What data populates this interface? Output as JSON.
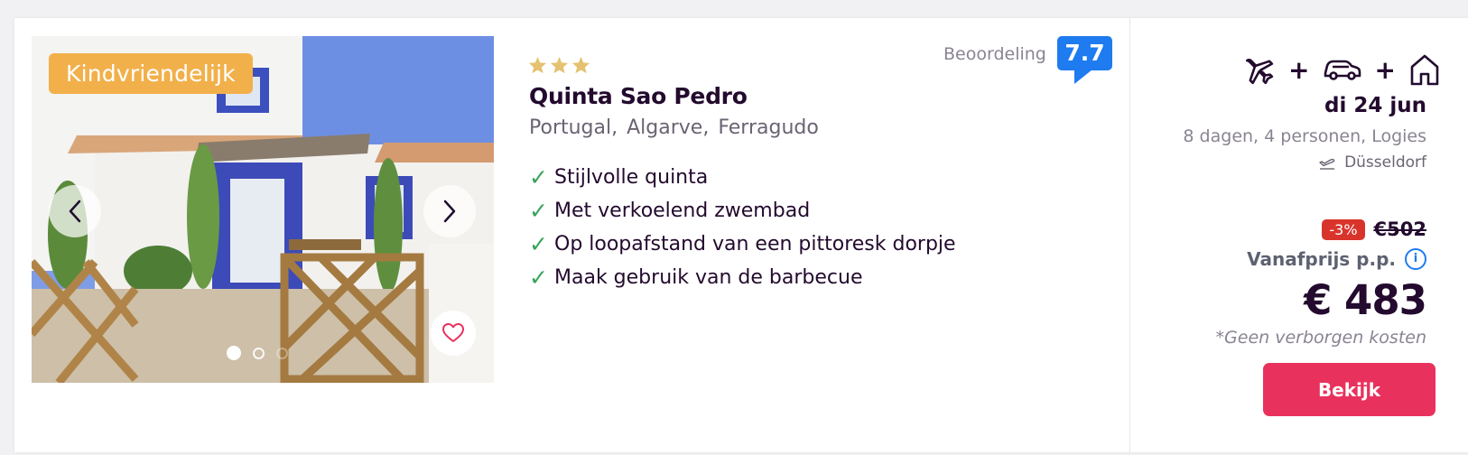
{
  "badge": {
    "label": "Kindvriendelijk"
  },
  "hotel": {
    "stars": 3,
    "name": "Quinta Sao Pedro",
    "location": [
      "Portugal,",
      "Algarve,",
      "Ferragudo"
    ]
  },
  "usps": [
    "Stijlvolle quinta",
    "Met verkoelend zwembad",
    "Op loopafstand van een pittoresk dorpje",
    "Maak gebruik van de barbecue"
  ],
  "rating": {
    "label": "Beoordeling",
    "score": "7.7"
  },
  "trip": {
    "transport_icons": [
      "plane-icon",
      "car-icon",
      "house-icon"
    ],
    "plus": "+",
    "date": "di 24 jun",
    "details": "8 dagen, 4 personen, Logies",
    "departure": "Düsseldorf"
  },
  "pricing": {
    "discount": "-3%",
    "old_price": "€502",
    "from_label": "Vanafprijs p.p.",
    "price": "€ 483",
    "note": "*Geen verborgen kosten",
    "cta": "Bekijk"
  },
  "carousel": {
    "total": 3,
    "active": 1
  },
  "colors": {
    "accent_pink": "#e8325d",
    "rating_blue": "#1e7bf0",
    "badge_orange": "#f2b04b",
    "check_green": "#3aa35a",
    "discount_red": "#d9342b"
  }
}
